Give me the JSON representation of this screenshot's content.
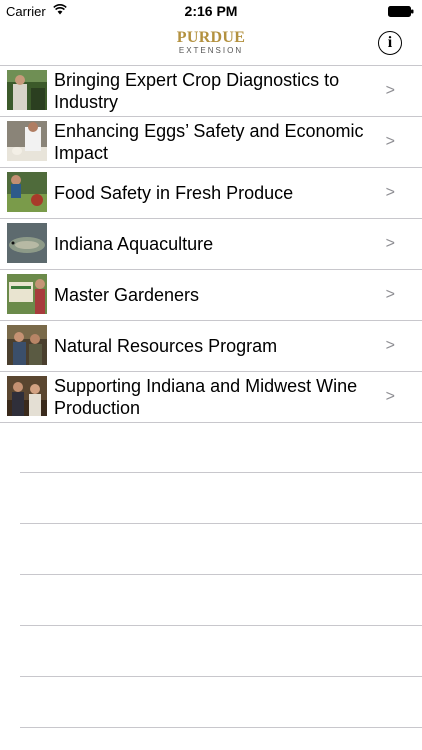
{
  "status_bar": {
    "carrier": "Carrier",
    "time": "2:16 PM",
    "wifi_icon": "wifi-icon",
    "battery_icon": "battery-icon"
  },
  "nav": {
    "logo_main": "PURDUE",
    "logo_sub": "EXTENSION",
    "info_label": "i",
    "info_icon": "info-circle-icon"
  },
  "colors": {
    "logo_gold": "#b3913f",
    "separator": "#c8c7cc",
    "chevron": "#8e8e93"
  },
  "items": [
    {
      "title": "Bringing Expert Crop Diagnostics to Industry",
      "chevron": ">"
    },
    {
      "title": "Enhancing Eggs’ Safety and Economic Impact",
      "chevron": ">"
    },
    {
      "title": "Food Safety in Fresh Produce",
      "chevron": ">"
    },
    {
      "title": "Indiana Aquaculture",
      "chevron": ">"
    },
    {
      "title": "Master Gardeners",
      "chevron": ">"
    },
    {
      "title": "Natural Resources Program",
      "chevron": ">"
    },
    {
      "title": "Supporting Indiana and Midwest Wine Production",
      "chevron": ">"
    }
  ]
}
